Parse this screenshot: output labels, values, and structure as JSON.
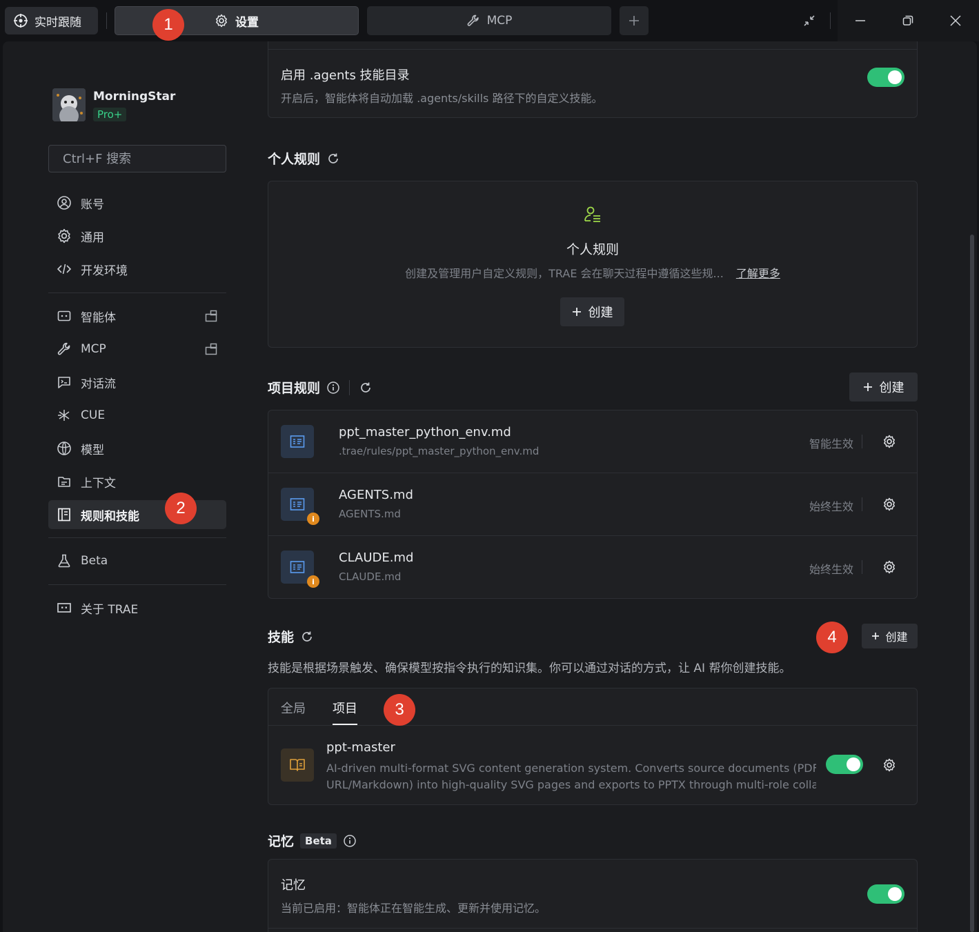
{
  "titlebar": {
    "follow_label": "实时跟随",
    "tabs": [
      {
        "label": "设置",
        "icon": "gear-icon"
      },
      {
        "label": "MCP",
        "icon": "wrench-icon"
      }
    ]
  },
  "sidebar": {
    "profile": {
      "name": "MorningStar",
      "plan": "Pro+"
    },
    "search_placeholder": "Ctrl+F 搜索",
    "items": [
      {
        "label": "账号",
        "icon": "account-icon"
      },
      {
        "label": "通用",
        "icon": "gear-icon"
      },
      {
        "label": "开发环境",
        "icon": "code-icon"
      },
      {
        "label": "智能体",
        "icon": "agent-icon"
      },
      {
        "label": "MCP",
        "icon": "wrench-icon"
      },
      {
        "label": "对话流",
        "icon": "chat-flow-icon"
      },
      {
        "label": "CUE",
        "icon": "cue-icon"
      },
      {
        "label": "模型",
        "icon": "model-icon"
      },
      {
        "label": "上下文",
        "icon": "context-icon"
      },
      {
        "label": "规则和技能",
        "icon": "rules-icon"
      },
      {
        "label": "Beta",
        "icon": "flask-icon"
      },
      {
        "label": "关于 TRAE",
        "icon": "about-icon"
      }
    ]
  },
  "agents_dir": {
    "title": "启用 .agents 技能目录",
    "desc": "开启后，智能体将自动加载 .agents/skills 路径下的自定义技能。",
    "enabled": true
  },
  "personal_rules": {
    "title": "个人规则",
    "empty_title": "个人规则",
    "empty_desc": "创建及管理用户自定义规则，TRAE 会在聊天过程中遵循这些规...",
    "learn_more": "了解更多",
    "create_label": "创建"
  },
  "project_rules": {
    "title": "项目规则",
    "create_label": "创建",
    "rows": [
      {
        "name": "ppt_master_python_env.md",
        "path": ".trae/rules/ppt_master_python_env.md",
        "status": "智能生效",
        "warning": false
      },
      {
        "name": "AGENTS.md",
        "path": "AGENTS.md",
        "status": "始终生效",
        "warning": true
      },
      {
        "name": "CLAUDE.md",
        "path": "CLAUDE.md",
        "status": "始终生效",
        "warning": true
      }
    ]
  },
  "skills": {
    "title": "技能",
    "create_label": "创建",
    "desc": "技能是根据场景触发、确保模型按指令执行的知识集。你可以通过对话的方式，让 AI 帮你创建技能。",
    "tabs": [
      "全局",
      "项目"
    ],
    "active_tab": "项目",
    "items": [
      {
        "name": "ppt-master",
        "desc_line1": "AI-driven multi-format SVG content generation system. Converts source documents (PDF/DOCX/",
        "desc_line2": "URL/Markdown) into high-quality SVG pages and exports to PPTX through multi-role collabora...",
        "enabled": true
      }
    ]
  },
  "memory": {
    "title": "记忆",
    "badge": "Beta",
    "item_title": "记忆",
    "item_desc": "当前已启用：智能体正在智能生成、更新并使用记忆。",
    "enabled": true
  },
  "markers": [
    "1",
    "2",
    "3",
    "4"
  ],
  "colors": {
    "accent_green": "#2fbf77",
    "marker_red": "#e0402f",
    "badge_green": "#38d38a"
  }
}
